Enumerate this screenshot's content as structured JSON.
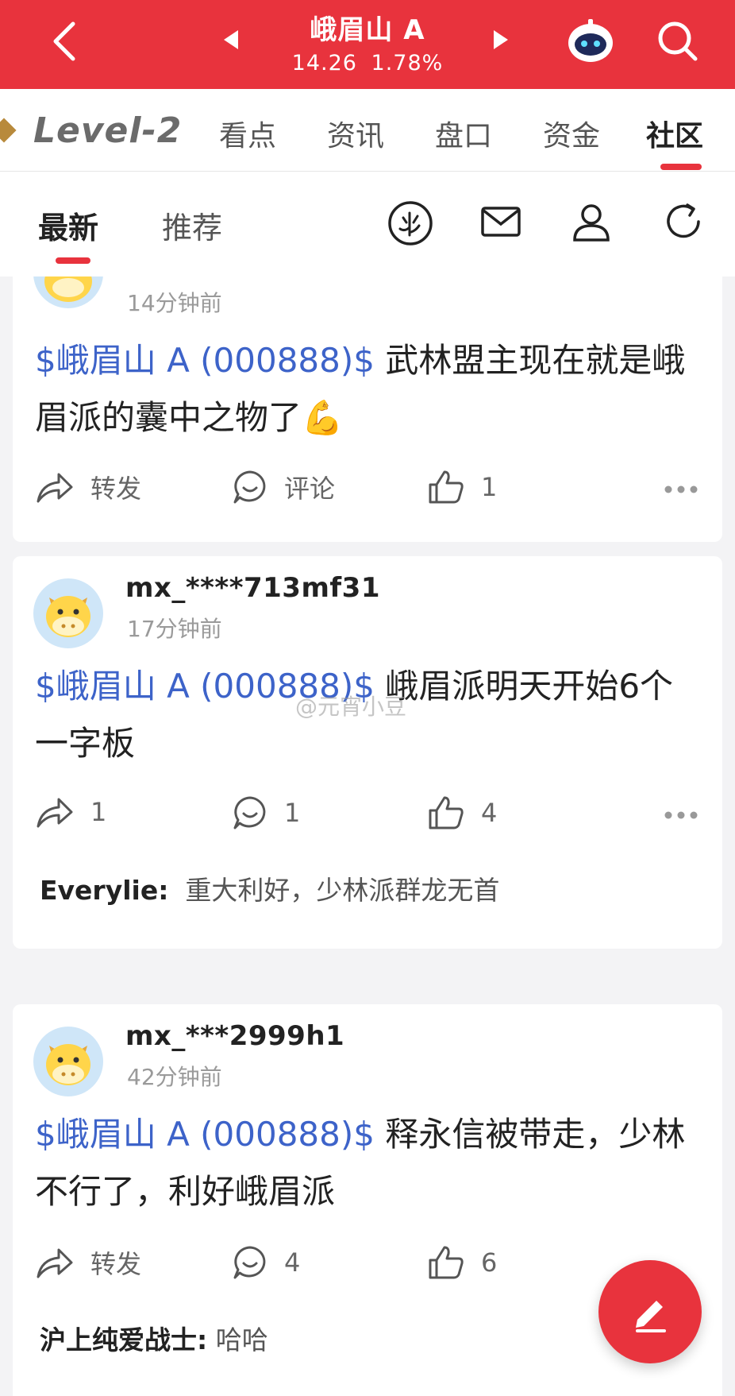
{
  "header": {
    "stock_name": "峨眉山 A",
    "price": "14.26",
    "change_pct": "1.78%",
    "accent_color": "#e8333d"
  },
  "tabs": {
    "level2": "Level-2",
    "items": [
      "看点",
      "资讯",
      "盘口",
      "资金",
      "社区"
    ],
    "active": "社区"
  },
  "subtabs": {
    "latest": "最新",
    "recommend": "推荐"
  },
  "posts": [
    {
      "username": "",
      "time": "14分钟前",
      "tag": "$峨眉山 A (000888)$",
      "text": " 武林盟主现在就是峨眉派的囊中之物了",
      "emoji": "💪",
      "share": "转发",
      "comment": "评论",
      "likes": "1"
    },
    {
      "username": "mx_****713mf31",
      "time": "17分钟前",
      "tag": "$峨眉山 A (000888)$",
      "text": " 峨眉派明天开始6个一字板",
      "share": "1",
      "comment": "1",
      "likes": "4",
      "reply_user": "Everylie:",
      "reply_text": "重大利好，少林派群龙无首"
    },
    {
      "username": "mx_***2999h1",
      "time": "42分钟前",
      "tag": "$峨眉山 A (000888)$",
      "text": " 释永信被带走，少林不行了，利好峨眉派",
      "share": "转发",
      "comment": "4",
      "likes": "6",
      "reply_user": "沪上纯爱战士:",
      "reply_text": "哈哈"
    }
  ],
  "watermark": "@元宵小豆",
  "icons": [
    "back-icon",
    "prev-stock-icon",
    "next-stock-icon",
    "robot-icon",
    "search-icon",
    "community-logo-icon",
    "mail-icon",
    "user-icon",
    "refresh-icon",
    "share-icon",
    "comment-icon",
    "like-icon",
    "more-icon",
    "edit-icon"
  ]
}
